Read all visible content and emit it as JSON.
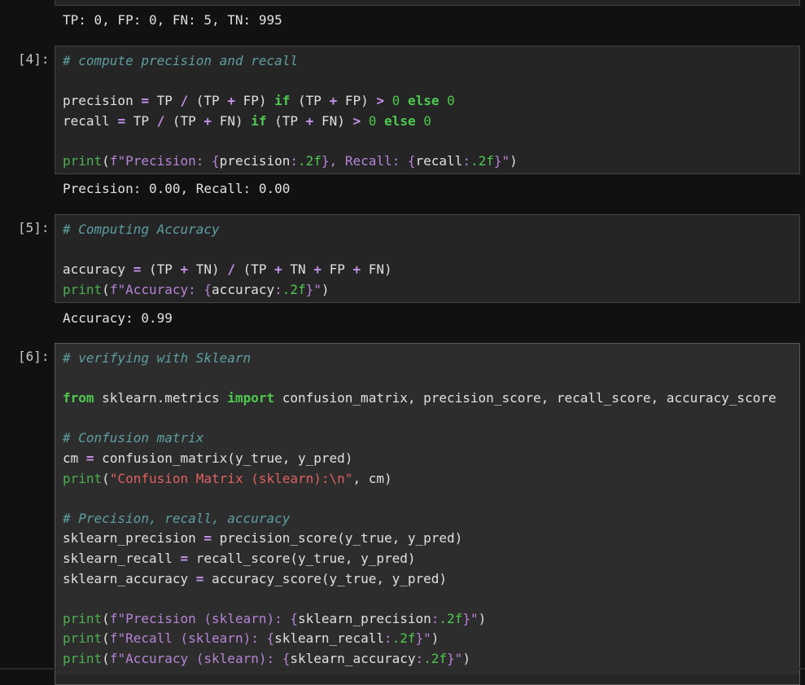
{
  "prev_output": "TP: 0, FP: 0, FN: 5, TN: 995",
  "cells": [
    {
      "prompt": "[4]:",
      "lines": [
        [
          {
            "t": "c",
            "v": "# compute precision and recall"
          }
        ],
        [],
        [
          {
            "t": "p",
            "v": "precision "
          },
          {
            "t": "o",
            "v": "="
          },
          {
            "t": "p",
            "v": " TP "
          },
          {
            "t": "o",
            "v": "/"
          },
          {
            "t": "p",
            "v": " (TP "
          },
          {
            "t": "o",
            "v": "+"
          },
          {
            "t": "p",
            "v": " FP) "
          },
          {
            "t": "k",
            "v": "if"
          },
          {
            "t": "p",
            "v": " (TP "
          },
          {
            "t": "o",
            "v": "+"
          },
          {
            "t": "p",
            "v": " FP) "
          },
          {
            "t": "o",
            "v": ">"
          },
          {
            "t": "p",
            "v": " "
          },
          {
            "t": "n",
            "v": "0"
          },
          {
            "t": "p",
            "v": " "
          },
          {
            "t": "k",
            "v": "else"
          },
          {
            "t": "p",
            "v": " "
          },
          {
            "t": "n",
            "v": "0"
          }
        ],
        [
          {
            "t": "p",
            "v": "recall "
          },
          {
            "t": "o",
            "v": "="
          },
          {
            "t": "p",
            "v": " TP "
          },
          {
            "t": "o",
            "v": "/"
          },
          {
            "t": "p",
            "v": " (TP "
          },
          {
            "t": "o",
            "v": "+"
          },
          {
            "t": "p",
            "v": " FN) "
          },
          {
            "t": "k",
            "v": "if"
          },
          {
            "t": "p",
            "v": " (TP "
          },
          {
            "t": "o",
            "v": "+"
          },
          {
            "t": "p",
            "v": " FN) "
          },
          {
            "t": "o",
            "v": ">"
          },
          {
            "t": "p",
            "v": " "
          },
          {
            "t": "n",
            "v": "0"
          },
          {
            "t": "p",
            "v": " "
          },
          {
            "t": "k",
            "v": "else"
          },
          {
            "t": "p",
            "v": " "
          },
          {
            "t": "n",
            "v": "0"
          }
        ],
        [],
        [
          {
            "t": "fn",
            "v": "print"
          },
          {
            "t": "p",
            "v": "("
          },
          {
            "t": "s",
            "v": "f\"Precision: {"
          },
          {
            "t": "p",
            "v": "precision"
          },
          {
            "t": "s",
            "v": ":"
          },
          {
            "t": "n",
            "v": ".2f"
          },
          {
            "t": "s",
            "v": "}, Recall: {"
          },
          {
            "t": "p",
            "v": "recall"
          },
          {
            "t": "s",
            "v": ":"
          },
          {
            "t": "n",
            "v": ".2f"
          },
          {
            "t": "s",
            "v": "}\""
          },
          {
            "t": "p",
            "v": ")"
          }
        ]
      ],
      "output": "Precision: 0.00, Recall: 0.00"
    },
    {
      "prompt": "[5]:",
      "lines": [
        [
          {
            "t": "c",
            "v": "# Computing Accuracy"
          }
        ],
        [],
        [
          {
            "t": "p",
            "v": "accuracy "
          },
          {
            "t": "o",
            "v": "="
          },
          {
            "t": "p",
            "v": " (TP "
          },
          {
            "t": "o",
            "v": "+"
          },
          {
            "t": "p",
            "v": " TN) "
          },
          {
            "t": "o",
            "v": "/"
          },
          {
            "t": "p",
            "v": " (TP "
          },
          {
            "t": "o",
            "v": "+"
          },
          {
            "t": "p",
            "v": " TN "
          },
          {
            "t": "o",
            "v": "+"
          },
          {
            "t": "p",
            "v": " FP "
          },
          {
            "t": "o",
            "v": "+"
          },
          {
            "t": "p",
            "v": " FN)"
          }
        ],
        [
          {
            "t": "fn",
            "v": "print"
          },
          {
            "t": "p",
            "v": "("
          },
          {
            "t": "s",
            "v": "f\"Accuracy: {"
          },
          {
            "t": "p",
            "v": "accuracy"
          },
          {
            "t": "s",
            "v": ":"
          },
          {
            "t": "n",
            "v": ".2f"
          },
          {
            "t": "s",
            "v": "}\""
          },
          {
            "t": "p",
            "v": ")"
          }
        ]
      ],
      "output": "Accuracy: 0.99"
    },
    {
      "prompt": "[6]:",
      "lines": [
        [
          {
            "t": "c",
            "v": "# verifying with Sklearn"
          }
        ],
        [],
        [
          {
            "t": "k",
            "v": "from"
          },
          {
            "t": "p",
            "v": " sklearn.metrics "
          },
          {
            "t": "k",
            "v": "import"
          },
          {
            "t": "p",
            "v": " confusion_matrix, precision_score, recall_score, accuracy_score"
          }
        ],
        [],
        [
          {
            "t": "c",
            "v": "# Confusion matrix"
          }
        ],
        [
          {
            "t": "p",
            "v": "cm "
          },
          {
            "t": "o",
            "v": "="
          },
          {
            "t": "p",
            "v": " confusion_matrix(y_true, y_pred)"
          }
        ],
        [
          {
            "t": "fn",
            "v": "print"
          },
          {
            "t": "p",
            "v": "("
          },
          {
            "t": "sr",
            "v": "\"Confusion Matrix (sklearn):\\n\""
          },
          {
            "t": "p",
            "v": ", cm)"
          }
        ],
        [],
        [
          {
            "t": "c",
            "v": "# Precision, recall, accuracy"
          }
        ],
        [
          {
            "t": "p",
            "v": "sklearn_precision "
          },
          {
            "t": "o",
            "v": "="
          },
          {
            "t": "p",
            "v": " precision_score(y_true, y_pred)"
          }
        ],
        [
          {
            "t": "p",
            "v": "sklearn_recall "
          },
          {
            "t": "o",
            "v": "="
          },
          {
            "t": "p",
            "v": " recall_score(y_true, y_pred)"
          }
        ],
        [
          {
            "t": "p",
            "v": "sklearn_accuracy "
          },
          {
            "t": "o",
            "v": "="
          },
          {
            "t": "p",
            "v": " accuracy_score(y_true, y_pred)"
          }
        ],
        [],
        [
          {
            "t": "fn",
            "v": "print"
          },
          {
            "t": "p",
            "v": "("
          },
          {
            "t": "s",
            "v": "f\"Precision (sklearn): {"
          },
          {
            "t": "p",
            "v": "sklearn_precision"
          },
          {
            "t": "s",
            "v": ":"
          },
          {
            "t": "n",
            "v": ".2f"
          },
          {
            "t": "s",
            "v": "}\""
          },
          {
            "t": "p",
            "v": ")"
          }
        ],
        [
          {
            "t": "fn",
            "v": "print"
          },
          {
            "t": "p",
            "v": "("
          },
          {
            "t": "s",
            "v": "f\"Recall (sklearn): {"
          },
          {
            "t": "p",
            "v": "sklearn_recall"
          },
          {
            "t": "s",
            "v": ":"
          },
          {
            "t": "n",
            "v": ".2f"
          },
          {
            "t": "s",
            "v": "}\""
          },
          {
            "t": "p",
            "v": ")"
          }
        ],
        [
          {
            "t": "fn",
            "v": "print"
          },
          {
            "t": "p",
            "v": "("
          },
          {
            "t": "s",
            "v": "f\"Accuracy (sklearn): {"
          },
          {
            "t": "p",
            "v": "sklearn_accuracy"
          },
          {
            "t": "s",
            "v": ":"
          },
          {
            "t": "n",
            "v": ".2f"
          },
          {
            "t": "s",
            "v": "}\""
          },
          {
            "t": "p",
            "v": ")"
          }
        ]
      ],
      "output": ""
    }
  ]
}
